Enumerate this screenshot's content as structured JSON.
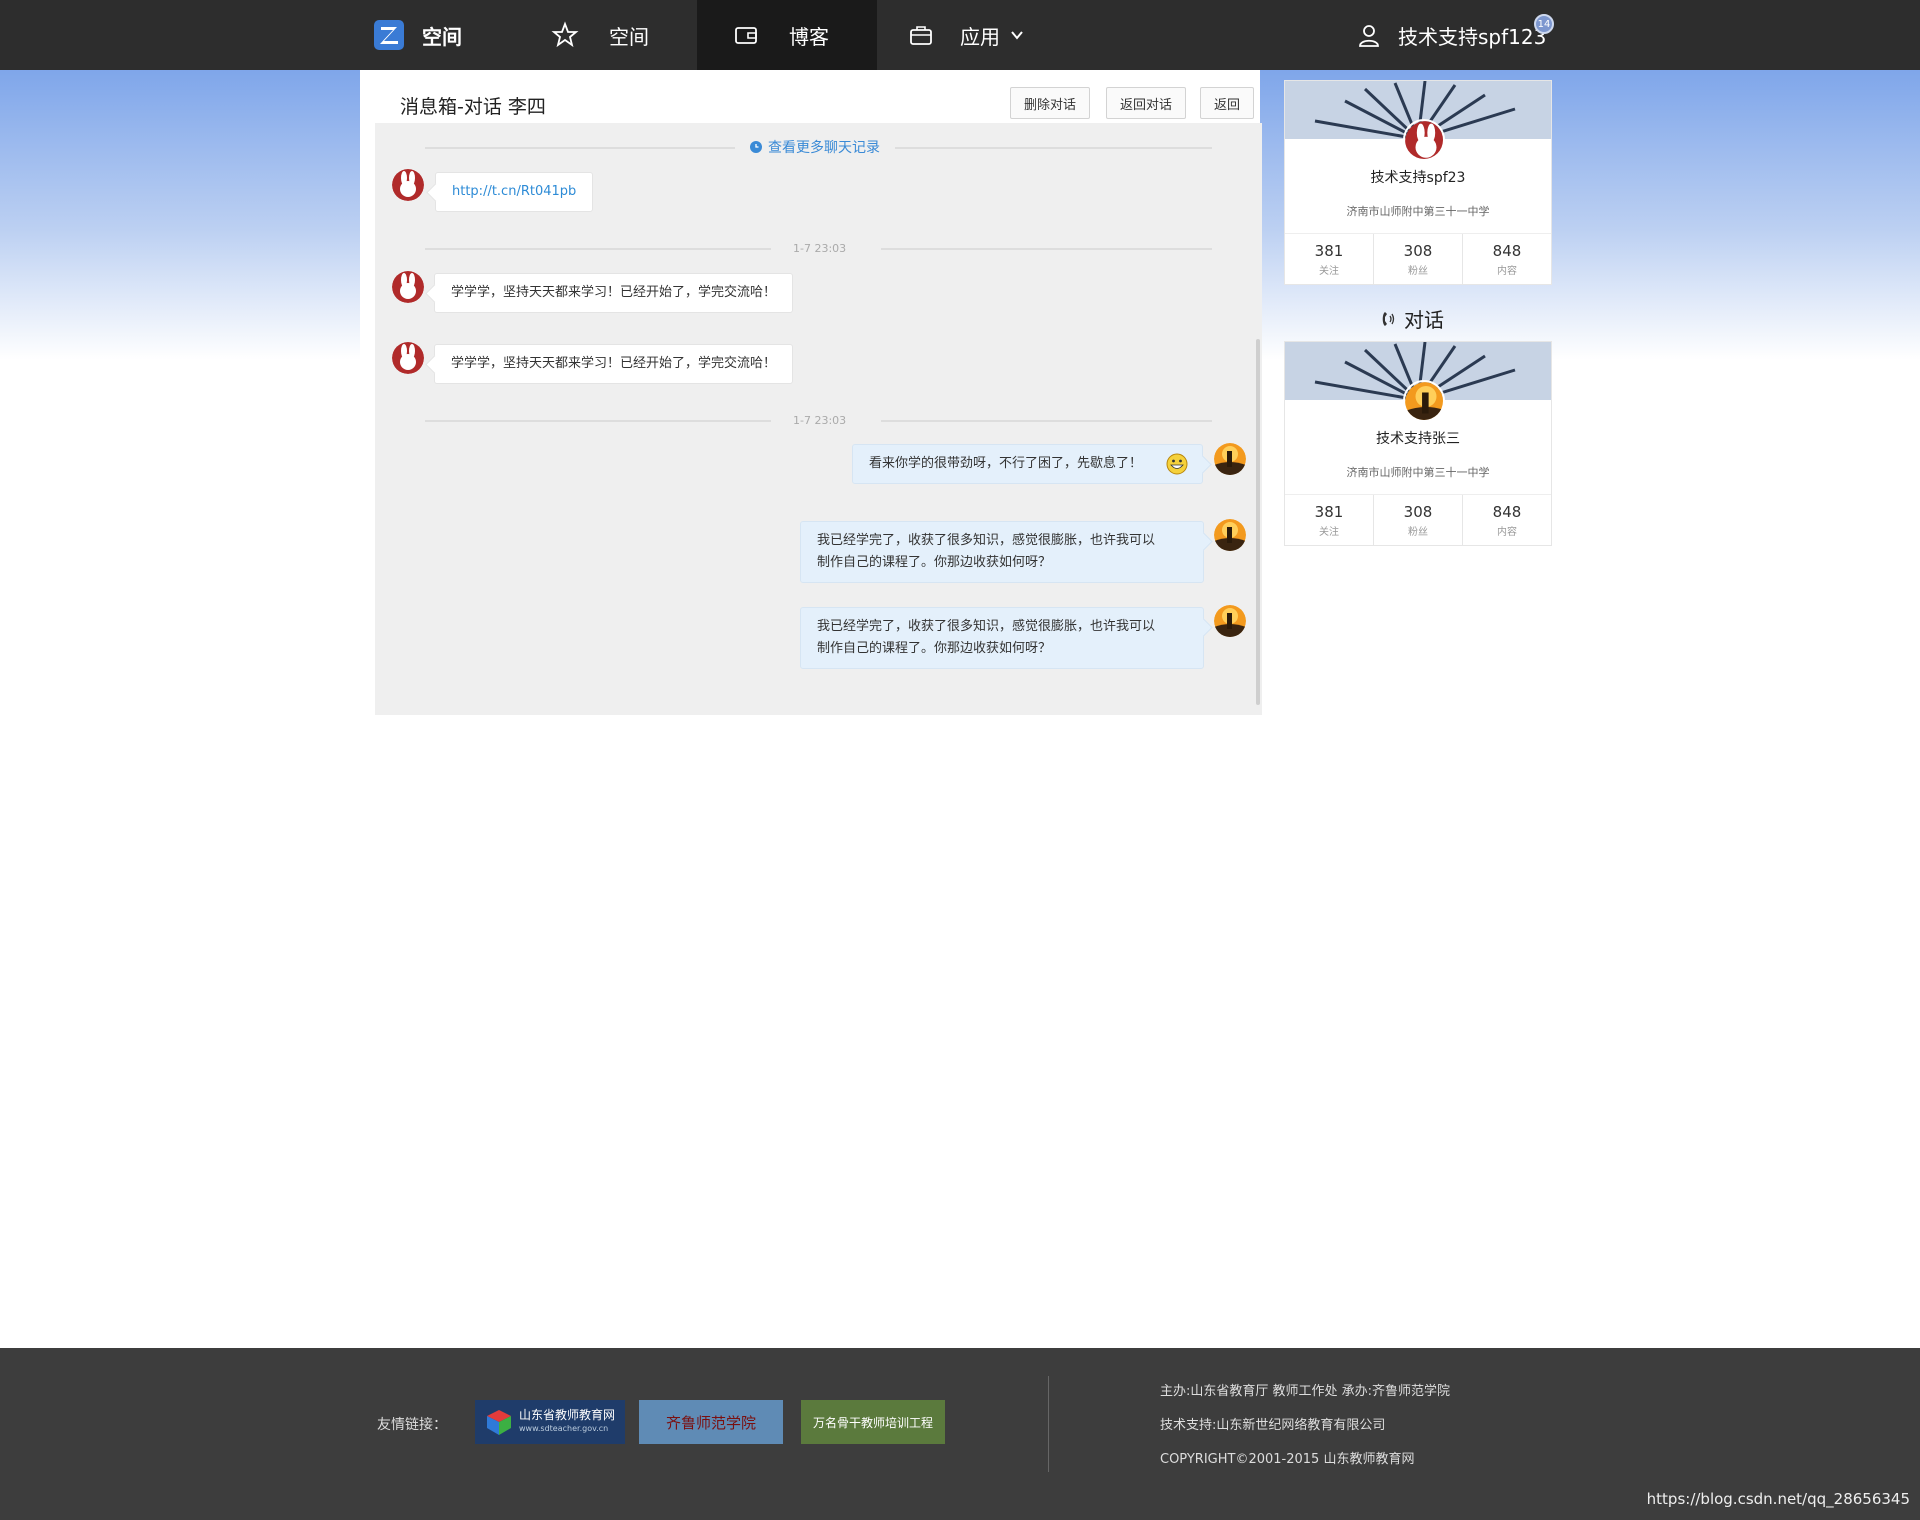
{
  "nav": {
    "logo_text": "空间",
    "items": [
      {
        "label": "空间"
      },
      {
        "label": "博客"
      },
      {
        "label": "应用"
      }
    ],
    "user_name": "技术支持spf123",
    "notification_count": "14"
  },
  "main": {
    "title": "消息箱-对话 李四",
    "buttons": {
      "delete": "删除对话",
      "back_dialog": "返回对话",
      "back": "返回"
    },
    "more_link": "查看更多聊天记录",
    "messages": [
      {
        "side": "left",
        "text": "http://t.cn/Rt041pb",
        "is_link": true
      },
      {
        "timestamp": "1-7 23:03"
      },
      {
        "side": "left",
        "text": "学学学，坚持天天都来学习！已经开始了，学完交流哈！"
      },
      {
        "side": "left",
        "text": "学学学，坚持天天都来学习！已经开始了，学完交流哈！"
      },
      {
        "timestamp": "1-7 23:03"
      },
      {
        "side": "right",
        "text": "看来你学的很带劲呀，不行了困了，先歇息了！",
        "emoji": "grin"
      },
      {
        "side": "right",
        "text_line1": "我已经学完了，收获了很多知识，感觉很膨胀，也许我可以",
        "text_line2": "制作自己的课程了。你那边收获如何呀？"
      },
      {
        "side": "right",
        "text_line1": "我已经学完了，收获了很多知识，感觉很膨胀，也许我可以",
        "text_line2": "制作自己的课程了。你那边收获如何呀？"
      }
    ]
  },
  "sidebar": {
    "profile": {
      "name": "技术支持spf23",
      "school": "济南市山师附中第三十一中学",
      "stats": [
        {
          "num": "381",
          "label": "关注"
        },
        {
          "num": "308",
          "label": "粉丝"
        },
        {
          "num": "848",
          "label": "内容"
        }
      ]
    },
    "dialog_title": "对话",
    "peer": {
      "name": "技术支持张三",
      "school": "济南市山师附中第三十一中学",
      "stats": [
        {
          "num": "381",
          "label": "关注"
        },
        {
          "num": "308",
          "label": "粉丝"
        },
        {
          "num": "848",
          "label": "内容"
        }
      ]
    }
  },
  "footer": {
    "links_label": "友情链接：",
    "logos": [
      {
        "text": "山东省教师教育网",
        "sub": "www.sdteacher.gov.cn",
        "color": "#1f3c6a"
      },
      {
        "text": "齐鲁师范学院",
        "color": "#5f8bb5"
      },
      {
        "text": "万名骨干教师培训工程",
        "color": "#5b7a3d"
      }
    ],
    "line1": "主办:山东省教育厅 教师工作处   承办:齐鲁师范学院",
    "line2": "技术支持:山东新世纪网络教育有限公司",
    "line3": "COPYRIGHT©2001-2015 山东教师教育网"
  },
  "watermark": "https://blog.csdn.net/qq_28656345",
  "colors": {
    "nav_bg": "#2d2d2d",
    "link": "#2d8bd6",
    "mine_bubble": "#e4f0fb"
  }
}
